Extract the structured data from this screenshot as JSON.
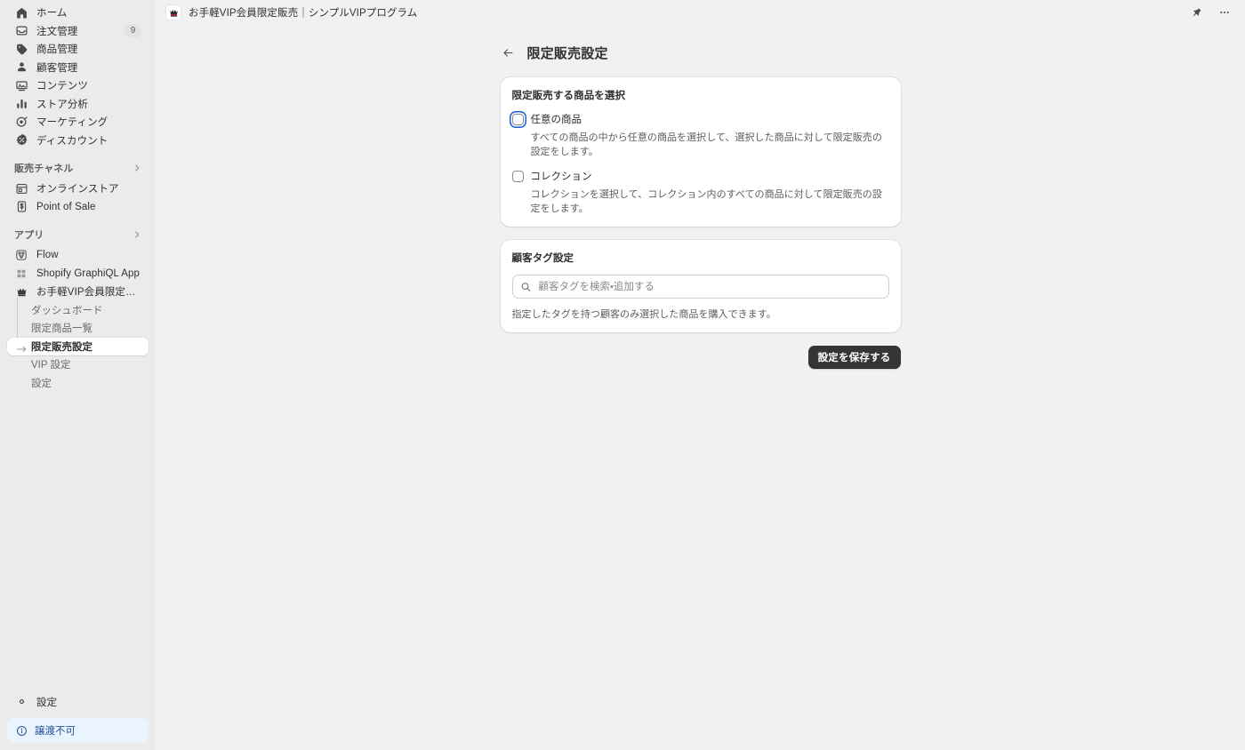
{
  "sidebar": {
    "primary_items": [
      {
        "label": "ホーム",
        "icon": "home-icon",
        "badge": null
      },
      {
        "label": "注文管理",
        "icon": "orders-icon",
        "badge": "9"
      },
      {
        "label": "商品管理",
        "icon": "products-icon",
        "badge": null
      },
      {
        "label": "顧客管理",
        "icon": "customers-icon",
        "badge": null
      },
      {
        "label": "コンテンツ",
        "icon": "content-icon",
        "badge": null
      },
      {
        "label": "ストア分析",
        "icon": "analytics-icon",
        "badge": null
      },
      {
        "label": "マーケティング",
        "icon": "marketing-icon",
        "badge": null
      },
      {
        "label": "ディスカウント",
        "icon": "discounts-icon",
        "badge": null
      }
    ],
    "sales_channels": {
      "title": "販売チャネル",
      "items": [
        {
          "label": "オンラインストア",
          "icon": "online-store-icon"
        },
        {
          "label": "Point of Sale",
          "icon": "pos-icon"
        }
      ]
    },
    "apps": {
      "title": "アプリ",
      "items": [
        {
          "label": "Flow",
          "icon": "flow-icon"
        },
        {
          "label": "Shopify GraphiQL App",
          "icon": "graphiql-icon"
        },
        {
          "label": "お手軽VIP会員限定販売｜シ...",
          "icon": "crown-icon"
        }
      ],
      "sub_items": [
        {
          "label": "ダッシュボード",
          "active": false
        },
        {
          "label": "限定商品一覧",
          "active": false
        },
        {
          "label": "限定販売設定",
          "active": true
        },
        {
          "label": "VIP 設定",
          "active": false
        },
        {
          "label": "設定",
          "active": false
        }
      ]
    },
    "settings": {
      "label": "設定",
      "icon": "gear-icon"
    },
    "banner": {
      "label": "譲渡不可",
      "icon": "info-icon",
      "color": "#1F5199",
      "background": "#EAF4FE"
    }
  },
  "topbar": {
    "app_icon": "crown-icon",
    "title": "お手軽VIP会員限定販売｜シンプルVIPプログラム",
    "pin_label": "pin-icon",
    "more_label": "more-icon"
  },
  "page": {
    "back_label": "back-arrow-icon",
    "title": "限定販売設定",
    "product_card": {
      "title": "限定販売する商品を選択",
      "options": [
        {
          "label": "任意の商品",
          "description": "すべての商品の中から任意の商品を選択して、選択した商品に対して限定販売の設定をします。",
          "checked": false,
          "focused": true
        },
        {
          "label": "コレクション",
          "description": "コレクションを選択して、コレクション内のすべての商品に対して限定販売の設定をします。",
          "checked": false,
          "focused": false
        }
      ]
    },
    "tag_card": {
      "title": "顧客タグ設定",
      "search_value": "",
      "search_placeholder": "顧客タグを検索・追加する",
      "help_text": "指定したタグを持つ顧客のみ選択した商品を購入できます。"
    },
    "save_label": "設定を保存する"
  }
}
